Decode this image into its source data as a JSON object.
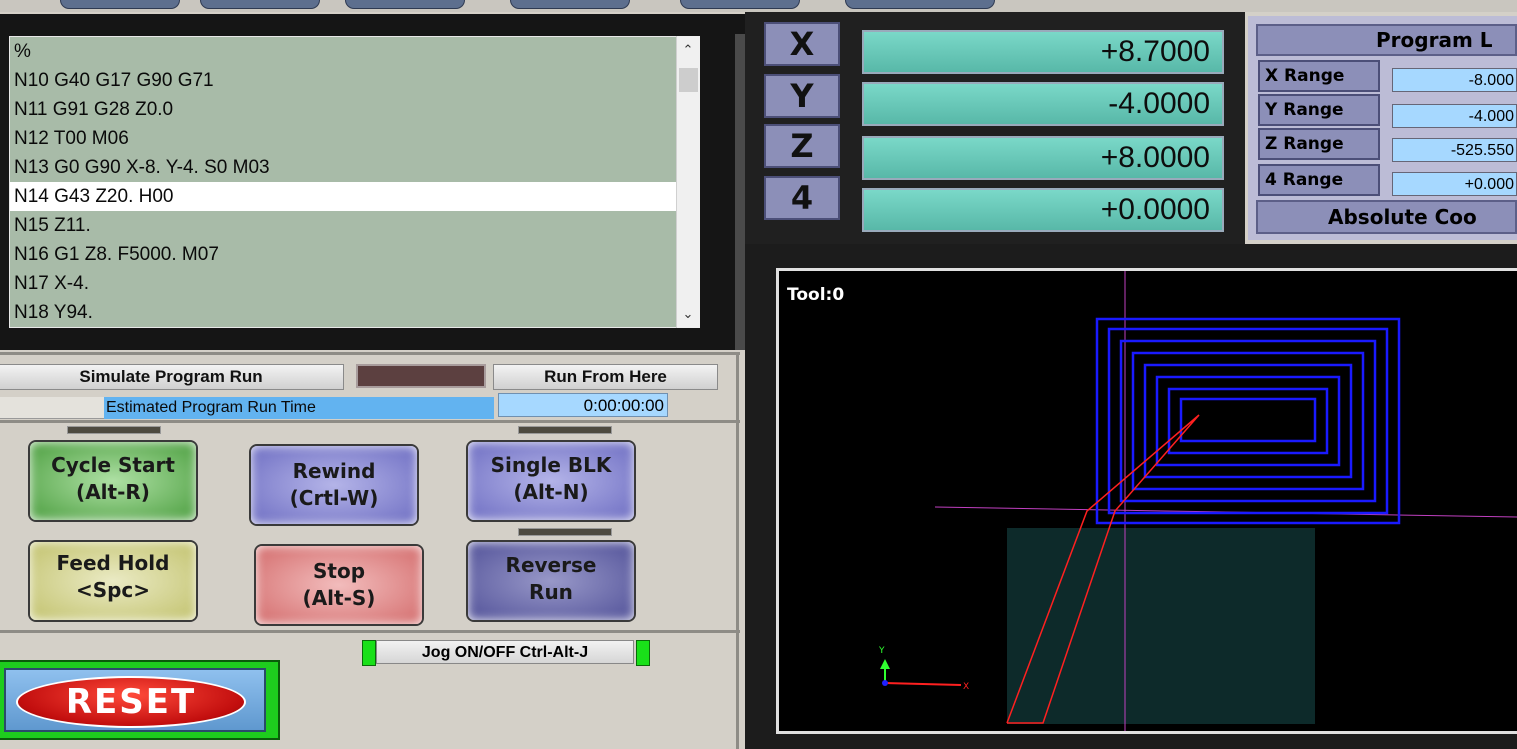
{
  "code": {
    "lines": [
      "%",
      "N10 G40 G17 G90 G71",
      "N11 G91 G28 Z0.0",
      "N12 T00 M06",
      "N13 G0 G90 X-8. Y-4. S0 M03",
      "N14 G43 Z20. H00",
      "N15 Z11.",
      "N16 G1 Z8. F5000. M07",
      "N17 X-4.",
      "N18 Y94."
    ],
    "selected_index": 5
  },
  "controls": {
    "simulate_label": "Simulate Program Run",
    "run_from_here_label": "Run From Here",
    "est_time_label": "Estimated Program Run Time",
    "est_time_value": "0:00:00:00",
    "cycle_start": [
      "Cycle Start",
      "(Alt-R)"
    ],
    "rewind": [
      "Rewind",
      "(Crtl-W)"
    ],
    "single_blk": [
      "Single BLK",
      "(Alt-N)"
    ],
    "feed_hold": [
      "Feed Hold",
      "<Spc>"
    ],
    "stop": [
      "Stop",
      "(Alt-S)"
    ],
    "reverse_run": [
      "Reverse",
      "Run"
    ],
    "jog_label": "Jog ON/OFF Ctrl-Alt-J",
    "reset_label": "RESET"
  },
  "dro": [
    {
      "axis": "X",
      "value": "+8.7000"
    },
    {
      "axis": "Y",
      "value": "-4.0000"
    },
    {
      "axis": "Z",
      "value": "+8.0000"
    },
    {
      "axis": "4",
      "value": "+0.0000"
    }
  ],
  "limits": {
    "title": "Program L",
    "ranges": [
      {
        "label": "X Range",
        "value": "-8.000"
      },
      {
        "label": "Y Range",
        "value": "-4.000"
      },
      {
        "label": "Z Range",
        "value": "-525.550"
      },
      {
        "label": "4 Range",
        "value": "+0.000"
      }
    ],
    "mode": "Absolute Coo"
  },
  "toolpath": {
    "tool_label": "Tool:0",
    "axis_y_label": "Y",
    "axis_x_label": "X",
    "path_color": "#1a1aff",
    "rapid_color": "#ff2020",
    "crosshair_color": "#c040c0",
    "stock_color": "#0d2a2a"
  }
}
